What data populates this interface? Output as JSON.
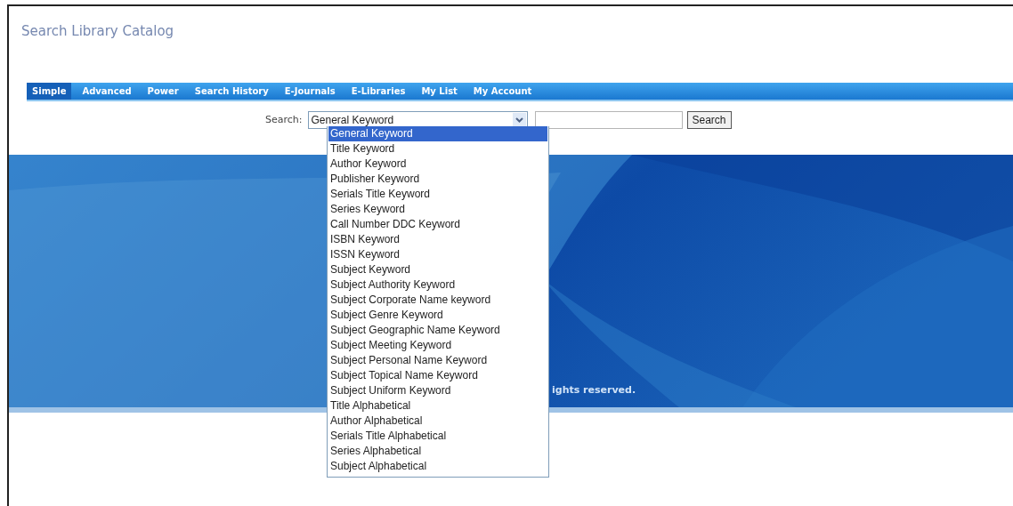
{
  "page": {
    "title": "Search Library Catalog"
  },
  "tabs": [
    {
      "label": "Simple",
      "selected": true
    },
    {
      "label": "Advanced",
      "selected": false
    },
    {
      "label": "Power",
      "selected": false
    },
    {
      "label": "Search History",
      "selected": false
    },
    {
      "label": "E-Journals",
      "selected": false
    },
    {
      "label": "E-Libraries",
      "selected": false
    },
    {
      "label": "My List",
      "selected": false
    },
    {
      "label": "My Account",
      "selected": false
    }
  ],
  "search": {
    "label": "Search:",
    "select_value": "General Keyword",
    "button": "Search",
    "options": [
      {
        "label": "General Keyword",
        "selected": true
      },
      {
        "label": "Title Keyword",
        "selected": false
      },
      {
        "label": "Author Keyword",
        "selected": false
      },
      {
        "label": "Publisher Keyword",
        "selected": false
      },
      {
        "label": "Serials Title Keyword",
        "selected": false
      },
      {
        "label": "Series Keyword",
        "selected": false
      },
      {
        "label": "Call Number DDC Keyword",
        "selected": false
      },
      {
        "label": "ISBN Keyword",
        "selected": false
      },
      {
        "label": "ISSN Keyword",
        "selected": false
      },
      {
        "label": "Subject Keyword",
        "selected": false
      },
      {
        "label": "Subject Authority Keyword",
        "selected": false
      },
      {
        "label": "Subject Corporate Name keyword",
        "selected": false
      },
      {
        "label": "Subject Genre Keyword",
        "selected": false
      },
      {
        "label": "Subject Geographic Name Keyword",
        "selected": false
      },
      {
        "label": "Subject Meeting Keyword",
        "selected": false
      },
      {
        "label": "Subject Personal Name Keyword",
        "selected": false
      },
      {
        "label": "Subject Topical Name Keyword",
        "selected": false
      },
      {
        "label": "Subject Uniform Keyword",
        "selected": false
      },
      {
        "label": "Title Alphabetical",
        "selected": false
      },
      {
        "label": "Author Alphabetical",
        "selected": false
      },
      {
        "label": "Serials Title Alphabetical",
        "selected": false
      },
      {
        "label": "Series Alphabetical",
        "selected": false
      },
      {
        "label": "Subject Alphabetical",
        "selected": false
      }
    ]
  },
  "banner": {
    "footer": "ights reserved."
  }
}
